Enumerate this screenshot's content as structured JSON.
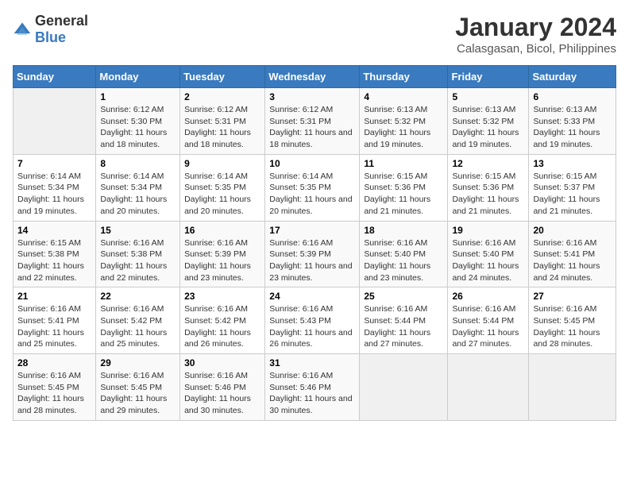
{
  "logo": {
    "text_general": "General",
    "text_blue": "Blue"
  },
  "title": "January 2024",
  "subtitle": "Calasgasan, Bicol, Philippines",
  "headers": [
    "Sunday",
    "Monday",
    "Tuesday",
    "Wednesday",
    "Thursday",
    "Friday",
    "Saturday"
  ],
  "weeks": [
    [
      {
        "day": "",
        "info": ""
      },
      {
        "day": "1",
        "info": "Sunrise: 6:12 AM\nSunset: 5:30 PM\nDaylight: 11 hours and 18 minutes."
      },
      {
        "day": "2",
        "info": "Sunrise: 6:12 AM\nSunset: 5:31 PM\nDaylight: 11 hours and 18 minutes."
      },
      {
        "day": "3",
        "info": "Sunrise: 6:12 AM\nSunset: 5:31 PM\nDaylight: 11 hours and 18 minutes."
      },
      {
        "day": "4",
        "info": "Sunrise: 6:13 AM\nSunset: 5:32 PM\nDaylight: 11 hours and 19 minutes."
      },
      {
        "day": "5",
        "info": "Sunrise: 6:13 AM\nSunset: 5:32 PM\nDaylight: 11 hours and 19 minutes."
      },
      {
        "day": "6",
        "info": "Sunrise: 6:13 AM\nSunset: 5:33 PM\nDaylight: 11 hours and 19 minutes."
      }
    ],
    [
      {
        "day": "7",
        "info": "Sunrise: 6:14 AM\nSunset: 5:34 PM\nDaylight: 11 hours and 19 minutes."
      },
      {
        "day": "8",
        "info": "Sunrise: 6:14 AM\nSunset: 5:34 PM\nDaylight: 11 hours and 20 minutes."
      },
      {
        "day": "9",
        "info": "Sunrise: 6:14 AM\nSunset: 5:35 PM\nDaylight: 11 hours and 20 minutes."
      },
      {
        "day": "10",
        "info": "Sunrise: 6:14 AM\nSunset: 5:35 PM\nDaylight: 11 hours and 20 minutes."
      },
      {
        "day": "11",
        "info": "Sunrise: 6:15 AM\nSunset: 5:36 PM\nDaylight: 11 hours and 21 minutes."
      },
      {
        "day": "12",
        "info": "Sunrise: 6:15 AM\nSunset: 5:36 PM\nDaylight: 11 hours and 21 minutes."
      },
      {
        "day": "13",
        "info": "Sunrise: 6:15 AM\nSunset: 5:37 PM\nDaylight: 11 hours and 21 minutes."
      }
    ],
    [
      {
        "day": "14",
        "info": "Sunrise: 6:15 AM\nSunset: 5:38 PM\nDaylight: 11 hours and 22 minutes."
      },
      {
        "day": "15",
        "info": "Sunrise: 6:16 AM\nSunset: 5:38 PM\nDaylight: 11 hours and 22 minutes."
      },
      {
        "day": "16",
        "info": "Sunrise: 6:16 AM\nSunset: 5:39 PM\nDaylight: 11 hours and 23 minutes."
      },
      {
        "day": "17",
        "info": "Sunrise: 6:16 AM\nSunset: 5:39 PM\nDaylight: 11 hours and 23 minutes."
      },
      {
        "day": "18",
        "info": "Sunrise: 6:16 AM\nSunset: 5:40 PM\nDaylight: 11 hours and 23 minutes."
      },
      {
        "day": "19",
        "info": "Sunrise: 6:16 AM\nSunset: 5:40 PM\nDaylight: 11 hours and 24 minutes."
      },
      {
        "day": "20",
        "info": "Sunrise: 6:16 AM\nSunset: 5:41 PM\nDaylight: 11 hours and 24 minutes."
      }
    ],
    [
      {
        "day": "21",
        "info": "Sunrise: 6:16 AM\nSunset: 5:41 PM\nDaylight: 11 hours and 25 minutes."
      },
      {
        "day": "22",
        "info": "Sunrise: 6:16 AM\nSunset: 5:42 PM\nDaylight: 11 hours and 25 minutes."
      },
      {
        "day": "23",
        "info": "Sunrise: 6:16 AM\nSunset: 5:42 PM\nDaylight: 11 hours and 26 minutes."
      },
      {
        "day": "24",
        "info": "Sunrise: 6:16 AM\nSunset: 5:43 PM\nDaylight: 11 hours and 26 minutes."
      },
      {
        "day": "25",
        "info": "Sunrise: 6:16 AM\nSunset: 5:44 PM\nDaylight: 11 hours and 27 minutes."
      },
      {
        "day": "26",
        "info": "Sunrise: 6:16 AM\nSunset: 5:44 PM\nDaylight: 11 hours and 27 minutes."
      },
      {
        "day": "27",
        "info": "Sunrise: 6:16 AM\nSunset: 5:45 PM\nDaylight: 11 hours and 28 minutes."
      }
    ],
    [
      {
        "day": "28",
        "info": "Sunrise: 6:16 AM\nSunset: 5:45 PM\nDaylight: 11 hours and 28 minutes."
      },
      {
        "day": "29",
        "info": "Sunrise: 6:16 AM\nSunset: 5:45 PM\nDaylight: 11 hours and 29 minutes."
      },
      {
        "day": "30",
        "info": "Sunrise: 6:16 AM\nSunset: 5:46 PM\nDaylight: 11 hours and 30 minutes."
      },
      {
        "day": "31",
        "info": "Sunrise: 6:16 AM\nSunset: 5:46 PM\nDaylight: 11 hours and 30 minutes."
      },
      {
        "day": "",
        "info": ""
      },
      {
        "day": "",
        "info": ""
      },
      {
        "day": "",
        "info": ""
      }
    ]
  ]
}
